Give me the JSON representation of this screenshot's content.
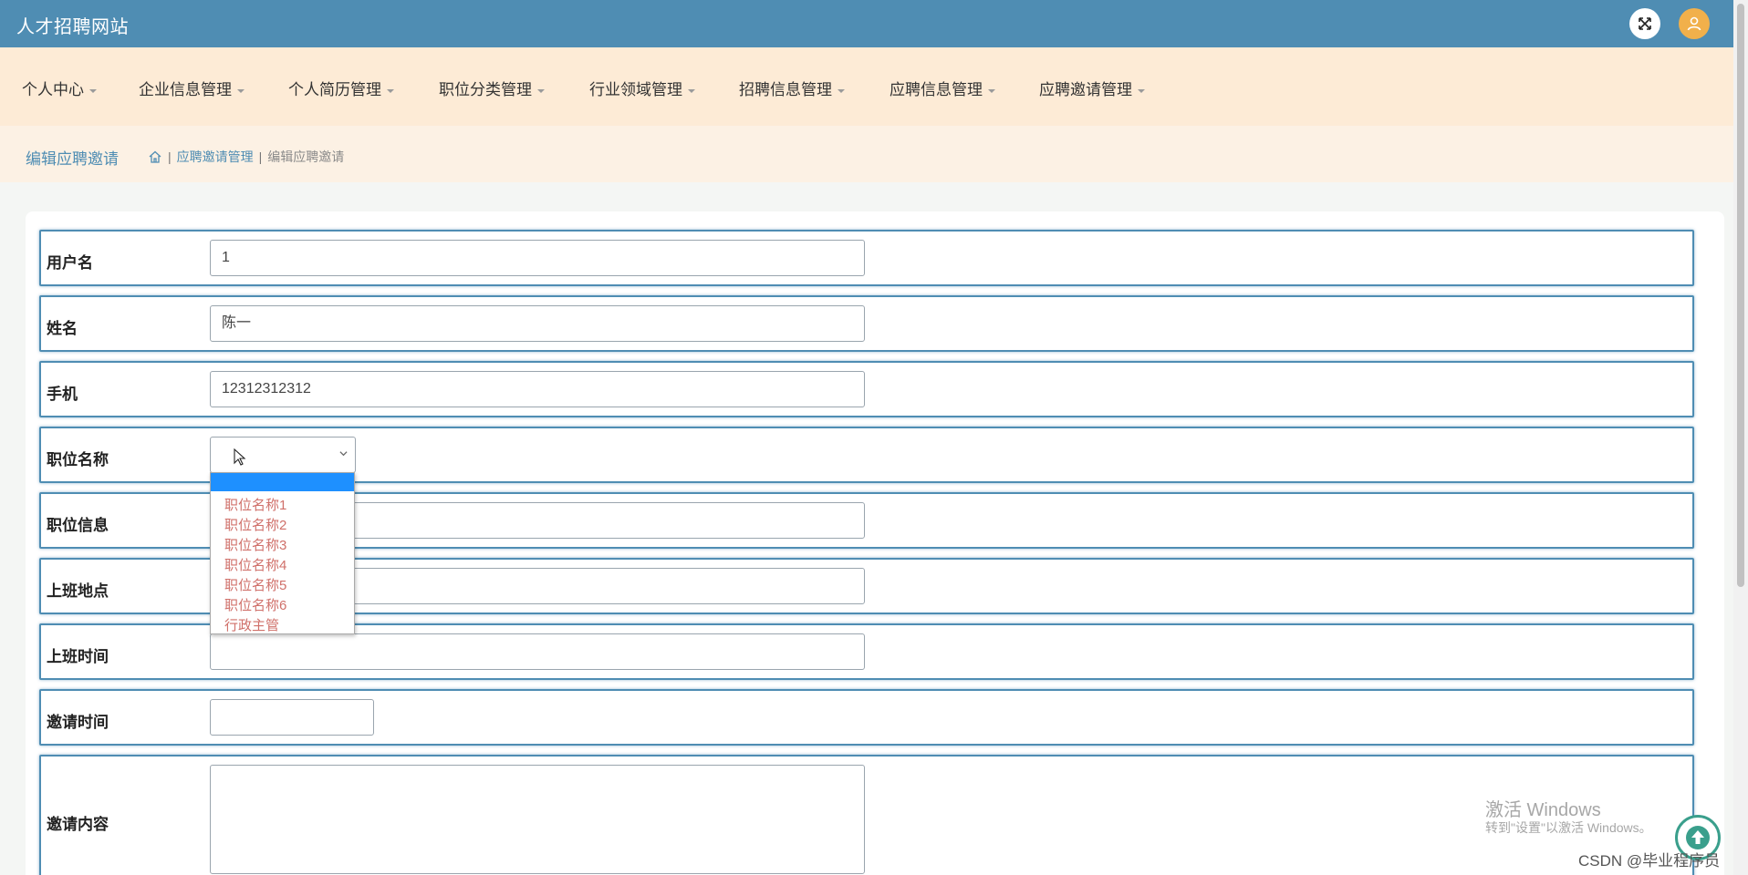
{
  "app": {
    "title": "人才招聘网站"
  },
  "nav": {
    "items": [
      {
        "label": "个人中心"
      },
      {
        "label": "企业信息管理"
      },
      {
        "label": "个人简历管理"
      },
      {
        "label": "职位分类管理"
      },
      {
        "label": "行业领域管理"
      },
      {
        "label": "招聘信息管理"
      },
      {
        "label": "应聘信息管理"
      },
      {
        "label": "应聘邀请管理"
      }
    ]
  },
  "breadcrumb": {
    "page_title": "编辑应聘邀请",
    "parent": "应聘邀请管理",
    "current": "编辑应聘邀请"
  },
  "form": {
    "username": {
      "label": "用户名",
      "value": "1"
    },
    "name": {
      "label": "姓名",
      "value": "陈一"
    },
    "phone": {
      "label": "手机",
      "value": "12312312312"
    },
    "position_name": {
      "label": "职位名称",
      "value": ""
    },
    "position_info": {
      "label": "职位信息",
      "value": ""
    },
    "work_location": {
      "label": "上班地点",
      "value": ""
    },
    "work_time": {
      "label": "上班时间",
      "value": ""
    },
    "invite_time": {
      "label": "邀请时间",
      "value": ""
    },
    "invite_content": {
      "label": "邀请内容",
      "value": ""
    }
  },
  "dropdown": {
    "options": [
      "职位名称1",
      "职位名称2",
      "职位名称3",
      "职位名称4",
      "职位名称5",
      "职位名称6",
      "行政主管"
    ]
  },
  "watermarks": {
    "windows_line1": "激活 Windows",
    "windows_line2": "转到\"设置\"以激活 Windows。",
    "csdn": "CSDN @毕业程序员"
  },
  "icons": {
    "fullscreen": "fullscreen-icon",
    "user": "user-icon",
    "home": "home-icon",
    "back_to_top": "arrow-up-icon"
  },
  "colors": {
    "header": "#4f8db3",
    "nav_bg": "#fdebd6",
    "avatar": "#f1b04b",
    "option_text": "#d0706a",
    "selected_option": "#1e90ff"
  }
}
